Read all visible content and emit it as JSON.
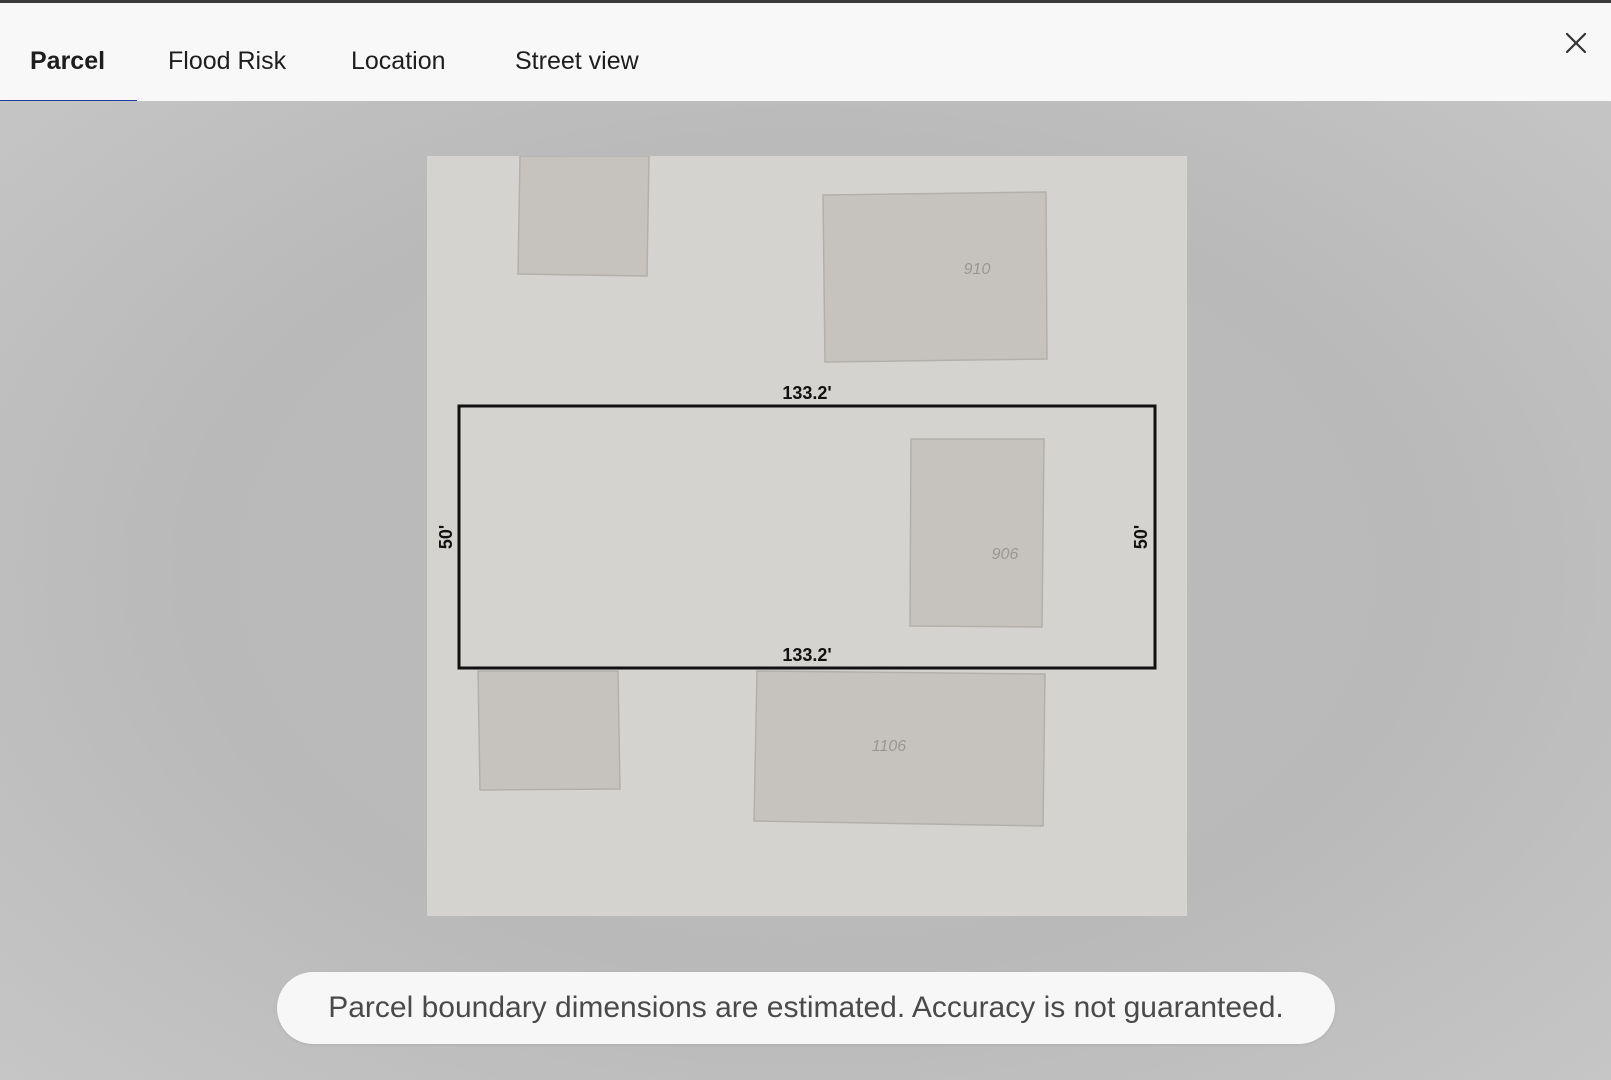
{
  "tabs": [
    {
      "label": "Parcel",
      "active": true
    },
    {
      "label": "Flood Risk",
      "active": false
    },
    {
      "label": "Location",
      "active": false
    },
    {
      "label": "Street view",
      "active": false
    }
  ],
  "colors": {
    "accent": "#1f3f9a",
    "map_background": "#d5d3cf",
    "building_fill": "#c6c3be",
    "parcel_outline": "#111111"
  },
  "icons": {
    "close": "close-icon"
  },
  "map": {
    "parcel": {
      "top_dimension": "133.2'",
      "bottom_dimension": "133.2'",
      "left_dimension": "50'",
      "right_dimension": "50'"
    },
    "building_labels": [
      "910",
      "906",
      "1106"
    ]
  },
  "disclaimer": "Parcel boundary dimensions are estimated. Accuracy is not guaranteed."
}
